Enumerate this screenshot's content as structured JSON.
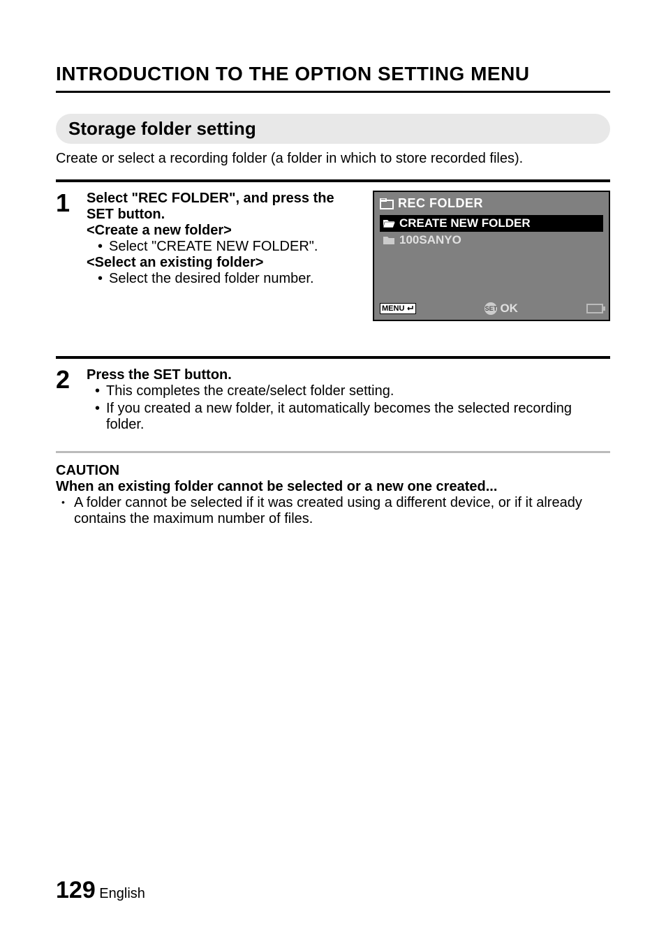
{
  "page": {
    "title": "INTRODUCTION TO THE OPTION SETTING MENU",
    "section": "Storage folder setting",
    "intro": "Create or select a recording folder (a folder in which to store recorded files).",
    "step1": {
      "num": "1",
      "heading": "Select \"REC FOLDER\", and press the SET button.",
      "create_label": "<Create a new folder>",
      "create_bullet": "Select \"CREATE NEW FOLDER\".",
      "select_label": "<Select an existing folder>",
      "select_bullet": "Select the desired folder number."
    },
    "screen": {
      "title": "REC FOLDER",
      "item_selected": "CREATE NEW FOLDER",
      "item_other": "100SANYO",
      "menu_label": "MENU",
      "ok_label": "OK",
      "set_label": "SET"
    },
    "step2": {
      "num": "2",
      "heading": "Press the SET button.",
      "bullet1": "This completes the create/select folder setting.",
      "bullet2": "If you created a new folder, it automatically becomes the selected recording folder."
    },
    "caution": {
      "title": "CAUTION",
      "subtitle": "When an existing folder cannot be selected or a new one created...",
      "bullet": "A folder cannot be selected if it was created using a different device, or if it already contains the maximum number of files."
    },
    "footer": {
      "page_num": "129",
      "lang": "English"
    }
  }
}
